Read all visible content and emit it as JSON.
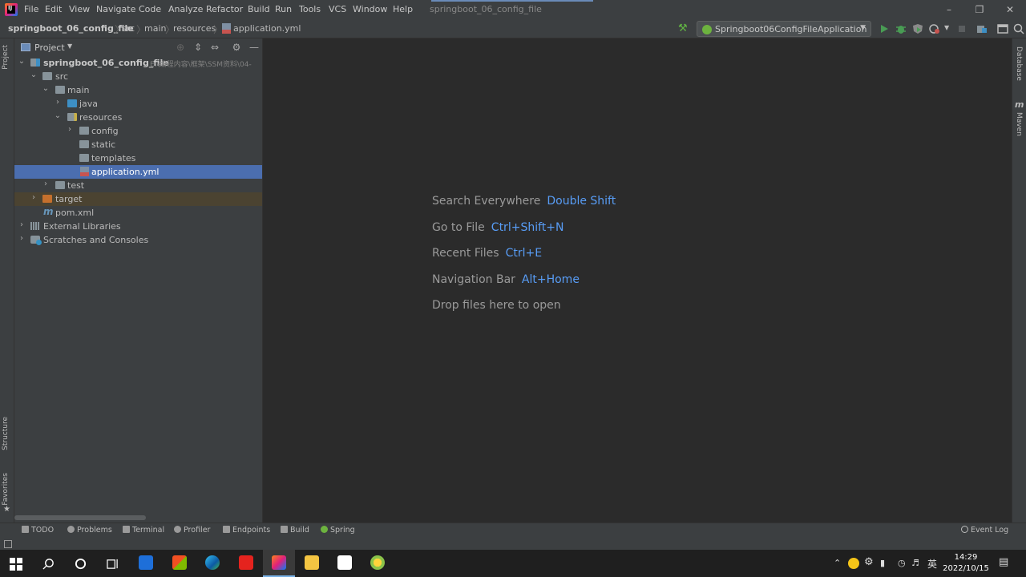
{
  "menubar": {
    "items": [
      "File",
      "Edit",
      "View",
      "Navigate",
      "Code",
      "Analyze",
      "Refactor",
      "Build",
      "Run",
      "Tools",
      "VCS",
      "Window",
      "Help"
    ],
    "project_title": "springboot_06_config_file"
  },
  "navbar": {
    "breadcrumbs": [
      "springboot_06_config_file",
      "src",
      "main",
      "resources",
      "application.yml"
    ],
    "run_config": "Springboot06ConfigFileApplication"
  },
  "left_strip": {
    "tabs": [
      "Project",
      "Structure",
      "Favorites"
    ]
  },
  "right_strip": {
    "tabs": [
      "Database",
      "Maven"
    ]
  },
  "project_panel": {
    "title": "Project",
    "tree": [
      {
        "label": "springboot_06_config_file",
        "path": "E:\\编程内容\\框架\\SSM资料\\04-",
        "expanded": true
      },
      {
        "label": "src",
        "expanded": true
      },
      {
        "label": "main",
        "expanded": true
      },
      {
        "label": "java",
        "expanded": false
      },
      {
        "label": "resources",
        "expanded": true
      },
      {
        "label": "config",
        "expanded": false
      },
      {
        "label": "static"
      },
      {
        "label": "templates"
      },
      {
        "label": "application.yml",
        "selected": true
      },
      {
        "label": "test",
        "expanded": false
      },
      {
        "label": "target",
        "expanded": false
      },
      {
        "label": "pom.xml"
      },
      {
        "label": "External Libraries",
        "expanded": false
      },
      {
        "label": "Scratches and Consoles",
        "expanded": false
      }
    ]
  },
  "editor": {
    "hints": [
      {
        "text": "Search Everywhere",
        "key": "Double Shift"
      },
      {
        "text": "Go to File",
        "key": "Ctrl+Shift+N"
      },
      {
        "text": "Recent Files",
        "key": "Ctrl+E"
      },
      {
        "text": "Navigation Bar",
        "key": "Alt+Home"
      },
      {
        "text": "Drop files here to open",
        "key": ""
      }
    ]
  },
  "toolwindows": [
    "TODO",
    "Problems",
    "Terminal",
    "Profiler",
    "Endpoints",
    "Build",
    "Spring"
  ],
  "event_log": "Event Log",
  "taskbar": {
    "ime": "英",
    "time": "14:29",
    "date": "2022/10/15"
  },
  "colors": {
    "accent": "#4b6eaf",
    "key_hint": "#589df6",
    "run_green": "#499c54"
  }
}
